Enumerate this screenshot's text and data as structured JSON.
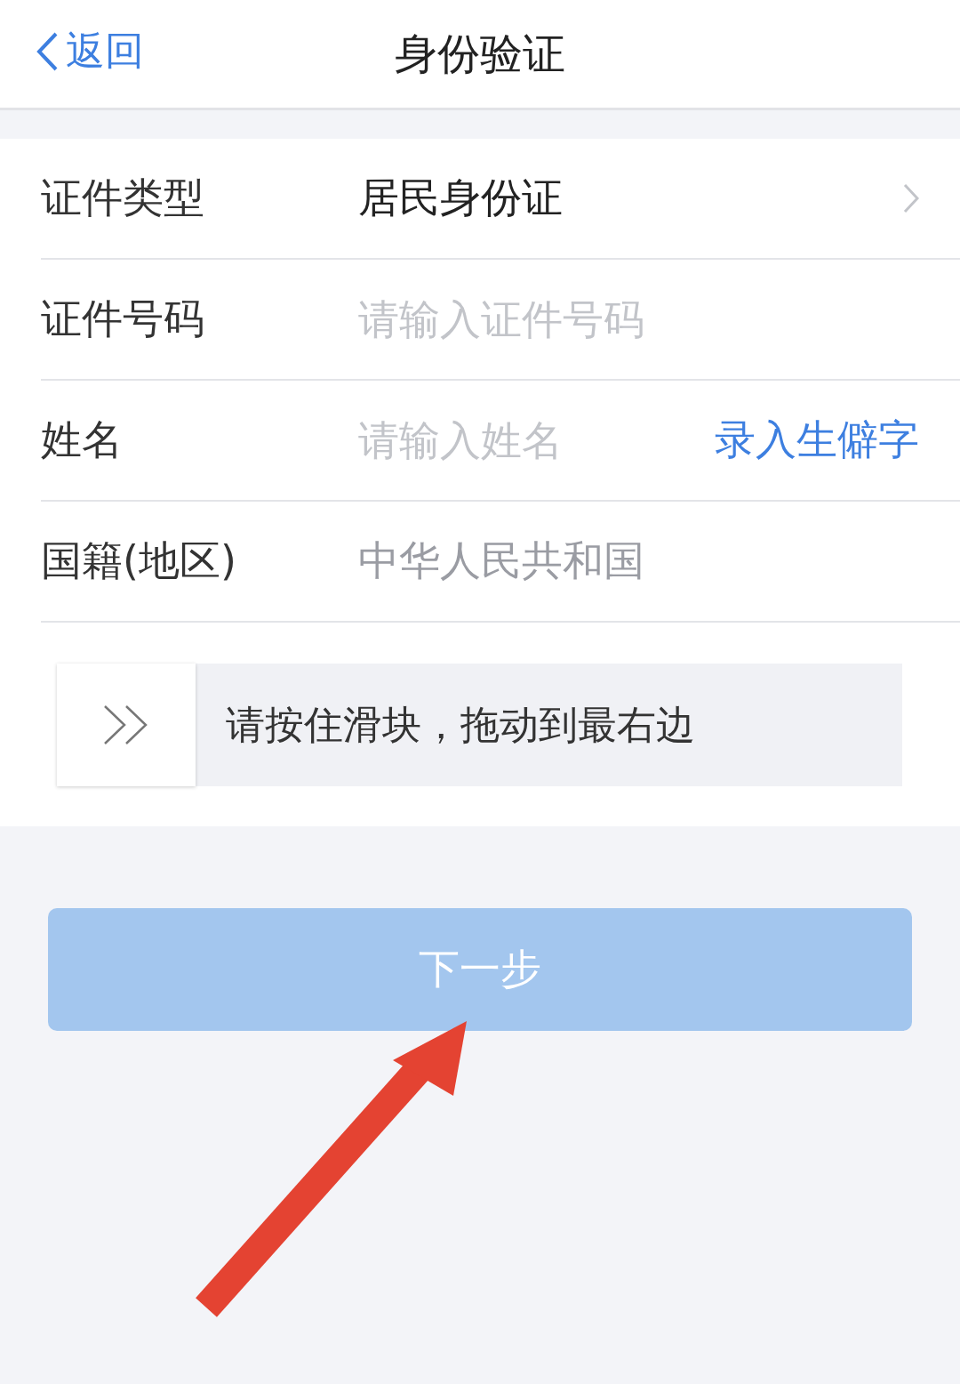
{
  "nav": {
    "back": "返回",
    "title": "身份验证"
  },
  "rows": [
    {
      "kind": "select",
      "label": "证件类型",
      "value": "居民身份证"
    },
    {
      "kind": "input",
      "label": "证件号码",
      "placeholder": "请输入证件号码"
    },
    {
      "kind": "input",
      "label": "姓名",
      "placeholder": "请输入姓名",
      "action": "录入生僻字"
    },
    {
      "kind": "static",
      "label": "国籍(地区)",
      "value": "中华人民共和国"
    }
  ],
  "slider": {
    "hint": "请按住滑块，拖动到最右边",
    "level": 0
  },
  "next_button": {
    "label": "下一步",
    "disabled": true
  }
}
